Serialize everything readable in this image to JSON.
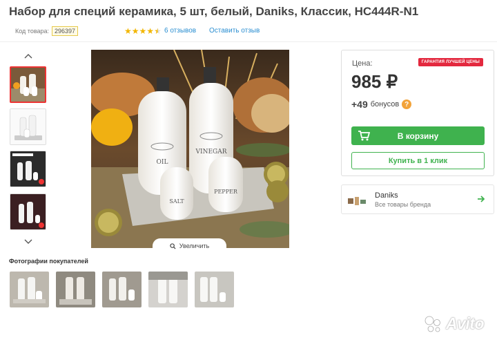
{
  "product": {
    "title": "Набор для специй керамика, 5 шт, белый, Daniks, Классик, HC444R-N1",
    "code_label": "Код товара:",
    "code": "296397",
    "rating": 4.5,
    "reviews_link": "6 отзывов",
    "leave_review": "Оставить отзыв"
  },
  "gallery": {
    "zoom_label": "Увеличить",
    "bottle_labels": {
      "oil": "OIL",
      "vinegar": "VINEGAR",
      "salt": "SALT",
      "pepper": "PEPPER"
    }
  },
  "buyer_photos": {
    "title": "Фотографии покупателей"
  },
  "buy_box": {
    "price_label": "Цена:",
    "guarantee": "ГАРАНТИЯ ЛУЧШЕЙ ЦЕНЫ",
    "price": "985 ₽",
    "bonus_value": "+49",
    "bonus_word": "бонусов",
    "cart_button": "В корзину",
    "one_click_button": "Купить в 1 клик"
  },
  "brand": {
    "name": "Daniks",
    "subtitle": "Все товары бренда"
  },
  "watermark": "Avito",
  "colors": {
    "accent_green": "#3fb24e",
    "link_blue": "#2a8ed1",
    "badge_red": "#e3283e",
    "star_yellow": "#f2b600"
  },
  "icons": {
    "up": "chevron-up-icon",
    "down": "chevron-down-icon",
    "zoom": "magnifier-icon",
    "cart": "cart-icon",
    "help": "question-icon",
    "arrow": "arrow-right-icon"
  }
}
